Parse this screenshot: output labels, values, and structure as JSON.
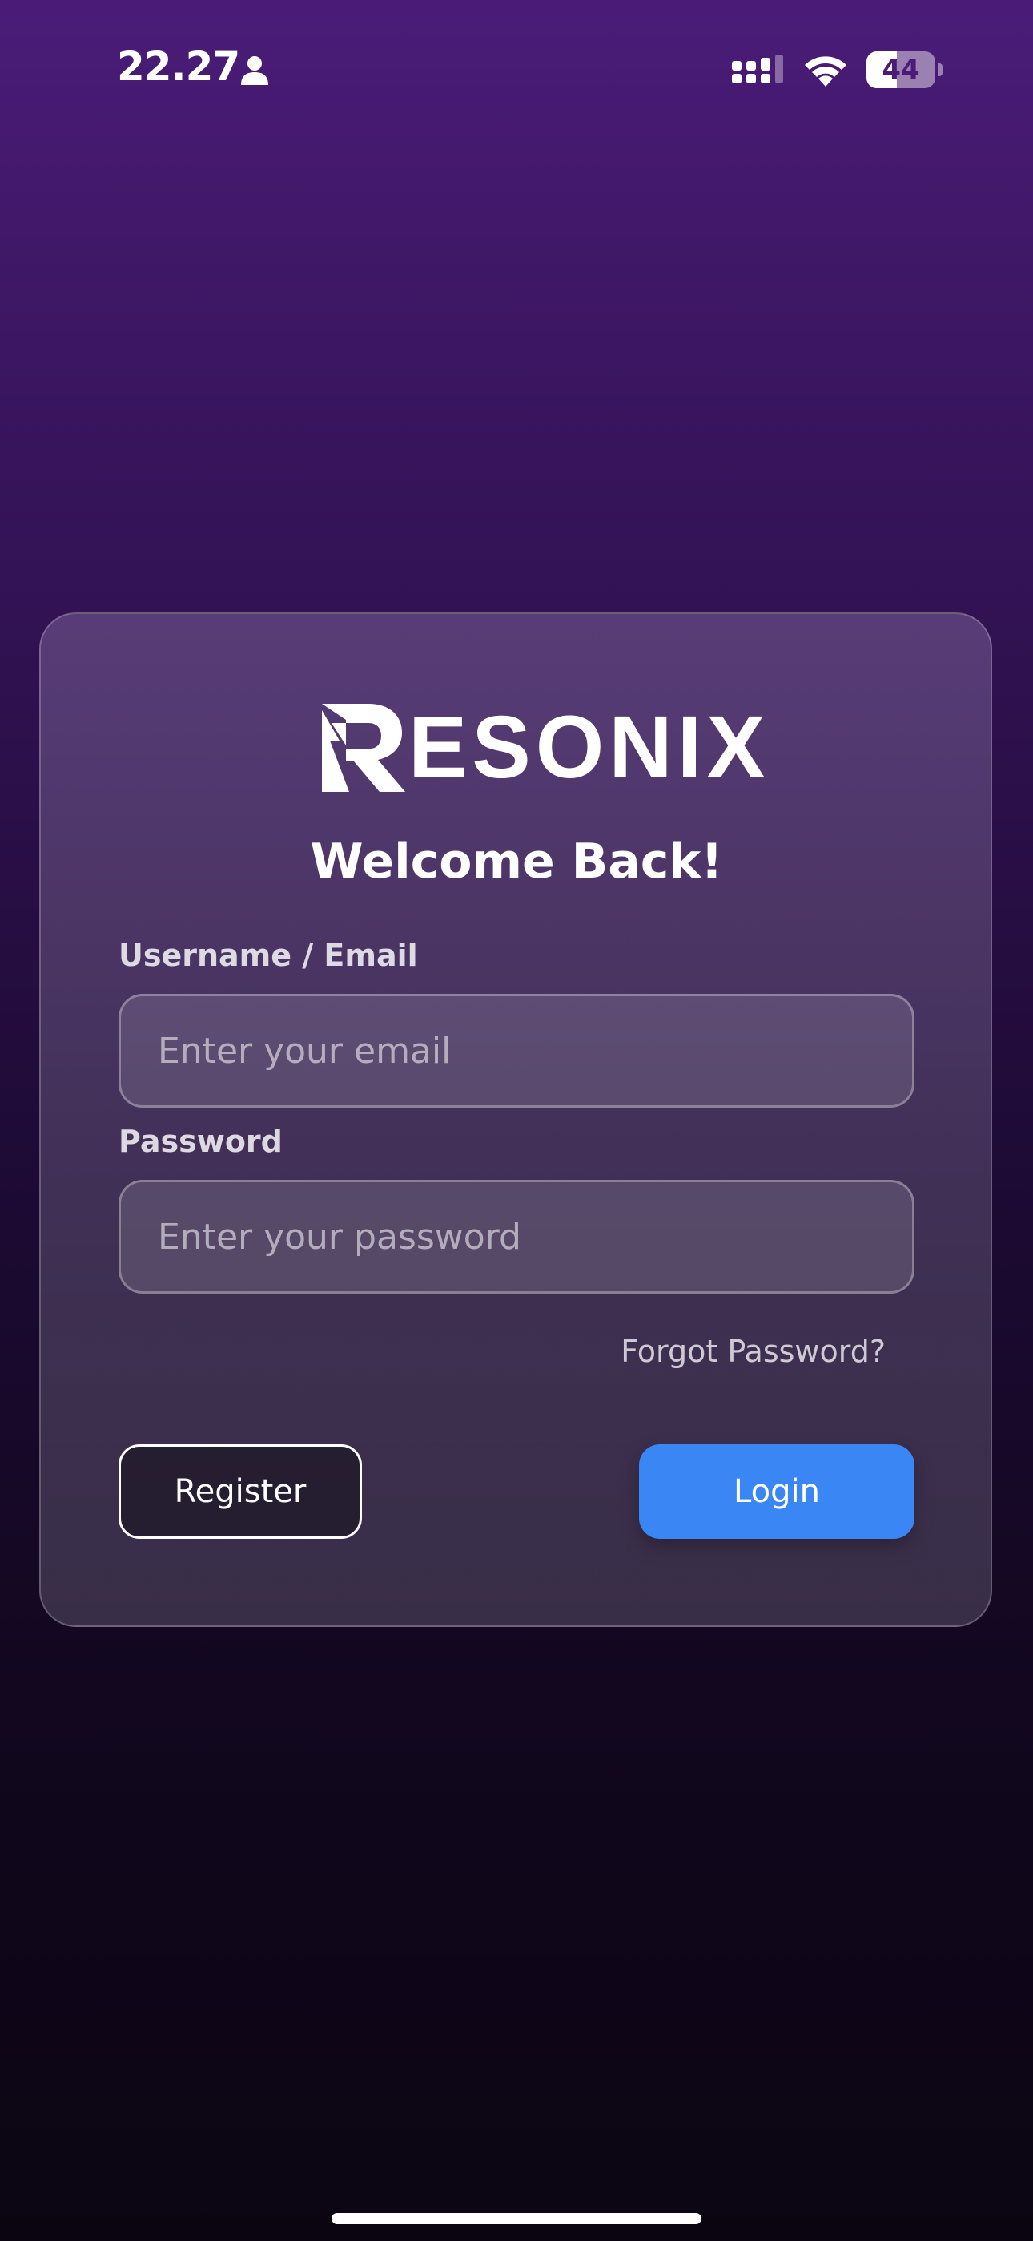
{
  "status_bar": {
    "time": "22.27",
    "battery_level": "44",
    "battery_fraction": 0.44
  },
  "brand": {
    "name": "ESONIX",
    "logo_mark_letter": "R"
  },
  "login": {
    "title": "Welcome Back!",
    "username_label": "Username / Email",
    "username_placeholder": "Enter your email",
    "username_value": "",
    "password_label": "Password",
    "password_placeholder": "Enter your password",
    "password_value": "",
    "forgot_label": "Forgot Password?",
    "register_label": "Register",
    "login_label": "Login"
  },
  "colors": {
    "background_top": "#4a1c78",
    "background_bottom": "#0b0512",
    "accent": "#3b86f5",
    "text": "#ffffff"
  },
  "icons": {
    "person": "person-icon",
    "signal": "cellular-signal-icon",
    "wifi": "wifi-icon",
    "battery": "battery-icon",
    "logo": "resonix-logo-mark"
  }
}
